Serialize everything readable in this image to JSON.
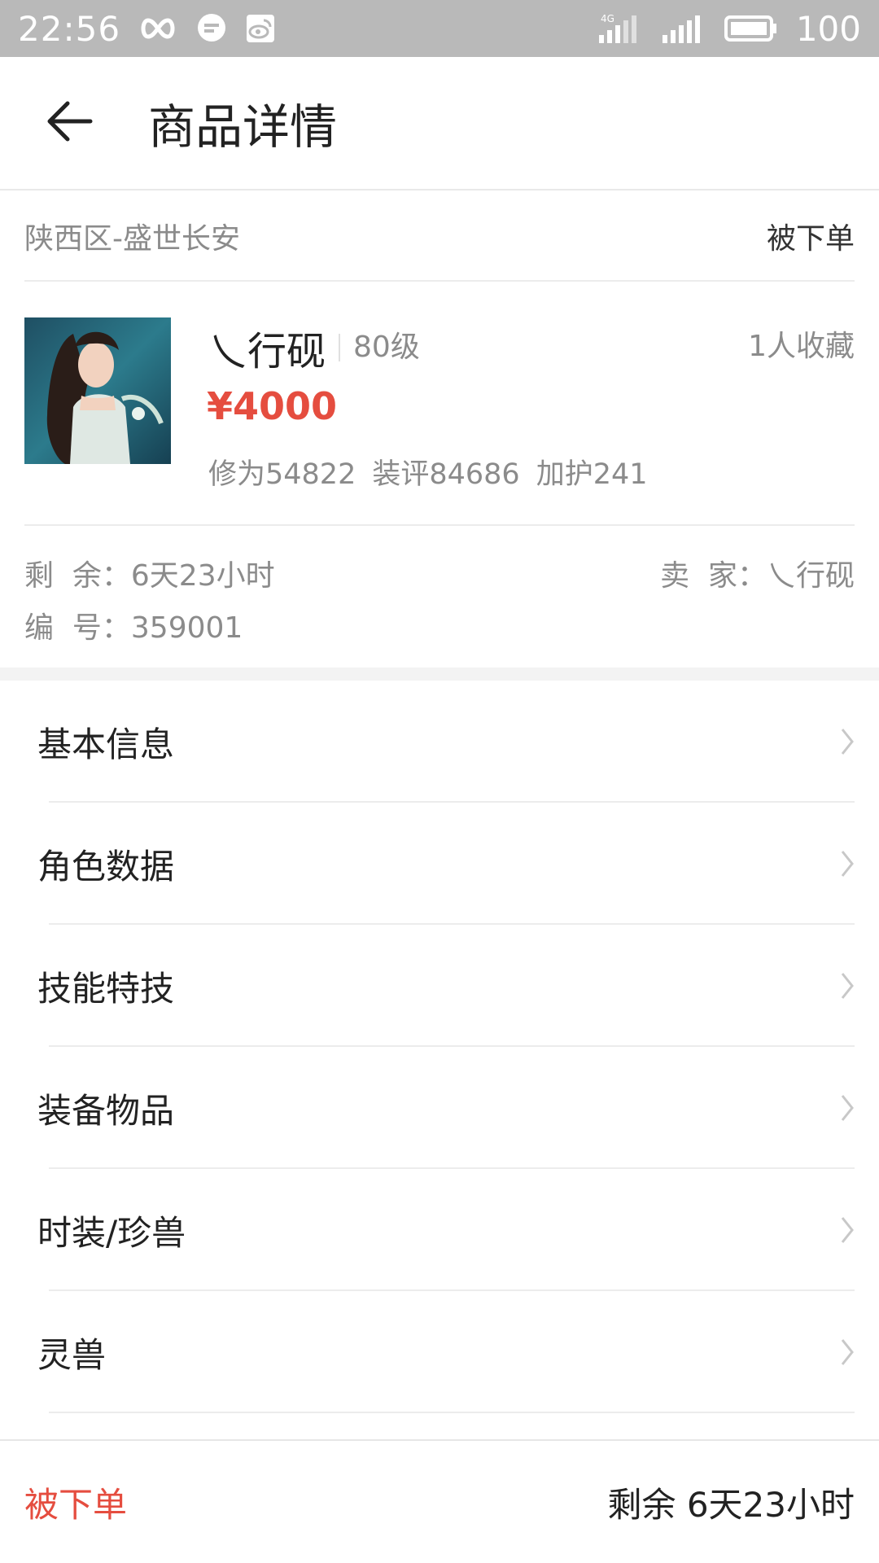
{
  "status_bar": {
    "time": "22:56",
    "battery": "100",
    "icons": [
      "infinity-icon",
      "chat-bubble-icon",
      "weibo-icon",
      "signal-4g-icon",
      "signal-icon",
      "battery-icon"
    ]
  },
  "header": {
    "title": "商品详情",
    "back_icon": "back-arrow-icon"
  },
  "region": {
    "name": "陕西区-盛世长安",
    "order_status": "被下单"
  },
  "product": {
    "name": "乀行砚",
    "level": "80级",
    "favorites": "1人收藏",
    "price": "¥4000",
    "stats": [
      "修为54822",
      "装评84686",
      "加护241"
    ],
    "thumb_icon": "character-portrait"
  },
  "meta": {
    "remaining": "剩  余：6天23小时",
    "seller": "卖  家：乀行砚",
    "serial": "编  号：359001"
  },
  "menu": {
    "items": [
      {
        "label": "基本信息"
      },
      {
        "label": "角色数据"
      },
      {
        "label": "技能特技"
      },
      {
        "label": "装备物品"
      },
      {
        "label": "时装/珍兽"
      },
      {
        "label": "灵兽"
      }
    ]
  },
  "bottom_bar": {
    "status": "被下单",
    "remaining": "剩余 6天23小时"
  },
  "colors": {
    "accent_red": "#e54d3f",
    "status_bar": "#b9b9b9",
    "secondary_text": "#8b8b8b"
  }
}
